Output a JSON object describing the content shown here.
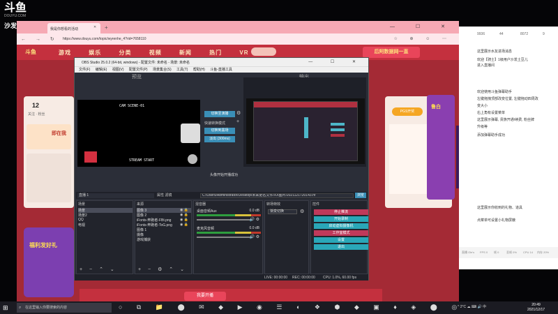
{
  "overlay": {
    "logo_text": "斗鱼",
    "room_id": "DOUYU.COM",
    "streamer_name": "沙发土豆儿"
  },
  "browser": {
    "tab_label": "我是你想看的活动",
    "url": "https://www.douyu.com/topic/wyrenhe_4?rid=7658110",
    "window_buttons": "— ☐ ✕",
    "nav_buttons": "← → ↻",
    "tools": "☆ ⊕ ☺ ⋯"
  },
  "site": {
    "logo": "斗鱼",
    "nav": [
      "游戏",
      "娱乐",
      "分类",
      "视频",
      "新闻",
      "热门",
      "VR"
    ],
    "banner": "后阿数据网一直",
    "left_num": "12",
    "left_text": "关注 · 粉丝",
    "left_card_title": "即在我",
    "promo_left": "福利发好礼",
    "right_button": "PGS开奖",
    "side_game": "鲁白",
    "bottom_button": "我要开播"
  },
  "obs": {
    "title": "OBS Studio 25.0.2 (64-bit, windows) - 配置文件: 未命名 - 场景: 未命名",
    "window_buttons": "— ☐ ✕",
    "menu": [
      "文件(F)",
      "编辑(E)",
      "视图(V)",
      "配置文件(P)",
      "场景集合(S)",
      "工具(T)",
      "帮助(H)",
      "斗鱼-直播工具"
    ],
    "preview_label": "预览",
    "program_label": "输出",
    "preview_pixel_top": "CAM  SCENE-01",
    "preview_pixel_bottom": "STREAM START",
    "transition": {
      "studio_button": "切换至演播",
      "label": "快速转换模式",
      "cut_button": "切换到黑场",
      "fade_label": "淡出 (300ms)",
      "status": "头像开始开播成功"
    },
    "path_bar": {
      "source_name": "直播 1",
      "options": "属性  滤镜",
      "path": "C:/Users/Administrator/Desktop/未来更名文件/XX图片/2021121720143.nf",
      "button": "浏览"
    },
    "scenes": {
      "title": "场景",
      "items": [
        "场景",
        "场景2",
        "QQ",
        "电视"
      ]
    },
    "sources": {
      "title": "来源",
      "items": [
        "图像 3",
        "图像 2",
        "iFonts-奔跑者-FBt.png",
        "iFonts-奔跑者-ToG.png",
        "图像 1",
        "摄像",
        "游戏捕获"
      ]
    },
    "mixer": {
      "title": "混音器",
      "tracks": [
        {
          "name": "桌面音频Aux",
          "db": "0.0 dB"
        },
        {
          "name": "麦克风音频",
          "db": "0.0 dB"
        }
      ]
    },
    "transitions_dock": {
      "title": "转场特效",
      "selected": "渐变切换"
    },
    "controls": {
      "title": "控件",
      "buttons": [
        "停止推流",
        "开始录制",
        "启动虚拟摄像机",
        "工作室模式",
        "设置",
        "退出"
      ]
    },
    "status": {
      "live": "LIVE: 00:00:00",
      "rec": "REC: 00:00:00",
      "cpu": "CPU: 1.0%, 60.00 fps"
    }
  },
  "chat": {
    "top_stats": [
      "9936",
      "44",
      "8072",
      "9"
    ],
    "messages": [
      "这里展示水友进场消息",
      "欢迎【骑士】1级用户沙发土豆儿",
      "进入直播间",
      "欢迎使用斗鱼弹幕助手",
      "左键拖拽顶部改变位置, 左键拖动四周改",
      "变大小",
      "右上角有设置菜单",
      "这里展示弹幕, 贵族开通/续费, 粉丝牌",
      "升级等",
      "添加弹幕助手成功",
      "这里展示你收到的礼物、道具",
      "点菜单可设置小礼物屏蔽"
    ],
    "stats": [
      "直播 Ole's",
      "FPS 0",
      "帧 0",
      "丢帧 0%",
      "CPU 14",
      "内存 20%"
    ]
  },
  "taskbar": {
    "start": "⊞",
    "search_placeholder": "在这里输入你要搜索的内容",
    "icons": "○ ⧉ 📁 ⬤ ✉ ◆ ▶ ◉ ☰ ◐ ❖ ⬢ ◆ ▣ ♦ ◈ ⬤ ◎",
    "tray": "^ 2°C ☁ ⌨ 🔊 中",
    "time": "20:49",
    "date": "2021/12/17"
  }
}
